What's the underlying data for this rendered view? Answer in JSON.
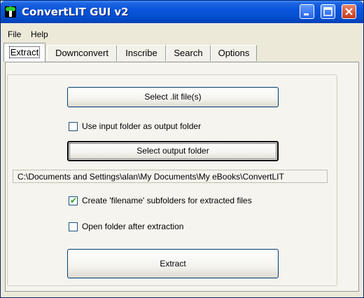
{
  "window": {
    "title": "ConvertLIT GUI v2"
  },
  "menu": {
    "items": [
      "File",
      "Help"
    ]
  },
  "tabs": [
    {
      "label": "Extract",
      "active": true
    },
    {
      "label": "Downconvert",
      "active": false
    },
    {
      "label": "Inscribe",
      "active": false
    },
    {
      "label": "Search",
      "active": false
    },
    {
      "label": "Options",
      "active": false
    }
  ],
  "extract": {
    "select_lit_label": "Select .lit file(s)",
    "use_input_folder": {
      "label": "Use input folder as output folder",
      "checked": false
    },
    "select_output_label": "Select output folder",
    "output_path": "C:\\Documents and Settings\\alan\\My Documents\\My eBooks\\ConvertLIT",
    "create_subfolders": {
      "label": "Create 'filename' subfolders for extracted files",
      "checked": true
    },
    "open_folder": {
      "label": "Open folder after extraction",
      "checked": false
    },
    "extract_label": "Extract"
  },
  "icons": {
    "app": "convertlit-app-icon",
    "check": "checkmark-icon"
  },
  "colors": {
    "titlebar": "#0855dd",
    "close_button": "#c4381a",
    "check": "#21a121"
  }
}
